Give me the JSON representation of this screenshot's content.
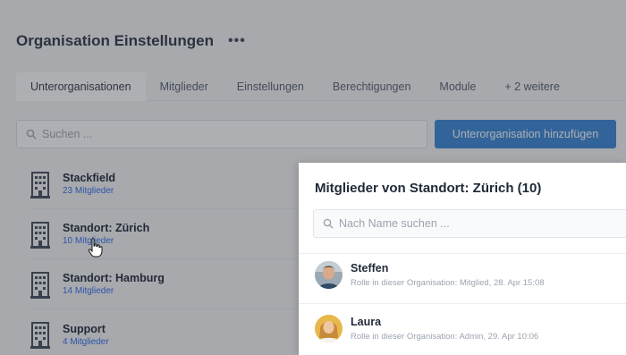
{
  "page": {
    "title": "Organisation Einstellungen",
    "more_icon": "more-horizontal-icon"
  },
  "tabs": [
    {
      "label": "Unterorganisationen",
      "active": true
    },
    {
      "label": "Mitglieder",
      "active": false
    },
    {
      "label": "Einstellungen",
      "active": false
    },
    {
      "label": "Berechtigungen",
      "active": false
    },
    {
      "label": "Module",
      "active": false
    },
    {
      "label": "+ 2 weitere",
      "active": false
    }
  ],
  "search": {
    "placeholder": "Suchen ..."
  },
  "add_button": {
    "label": "Unterorganisation hinzufügen",
    "color": "#2b7fd6"
  },
  "orgs": [
    {
      "name": "Stackfield",
      "members": "23 Mitglieder"
    },
    {
      "name": "Standort: Zürich",
      "members": "10 Mitglieder"
    },
    {
      "name": "Standort: Hamburg",
      "members": "14 Mitglieder"
    },
    {
      "name": "Support",
      "members": "4 Mitglieder"
    }
  ],
  "panel": {
    "title": "Mitglieder von Standort: Zürich (10)",
    "search_placeholder": "Nach Name suchen ...",
    "members": [
      {
        "name": "Steffen",
        "role": "Rolle in dieser Organisation: Mitglied, 28. Apr 15:08"
      },
      {
        "name": "Laura",
        "role": "Rolle in dieser Organisation: Admin, 29. Apr 10:06"
      }
    ]
  }
}
